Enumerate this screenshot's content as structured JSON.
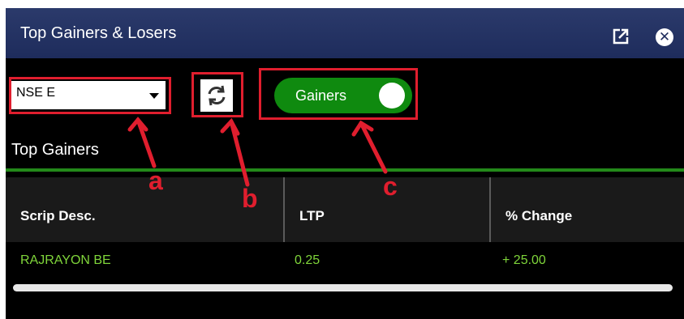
{
  "window": {
    "title": "Top Gainers & Losers",
    "popout_icon": "external-link-icon",
    "close_icon": "close-circle-icon"
  },
  "toolbar": {
    "exchange_select": {
      "value": "NSE E",
      "arrow_icon": "caret-down-icon"
    },
    "refresh_icon": "refresh-icon",
    "toggle": {
      "label": "Gainers",
      "state": "on",
      "color": "#0f8a0f"
    }
  },
  "section": {
    "title": "Top Gainers"
  },
  "table": {
    "columns": [
      "Scrip Desc.",
      "LTP",
      "% Change"
    ],
    "rows": [
      {
        "scrip": "RAJRAYON BE",
        "ltp": "0.25",
        "change": "+ 25.00"
      }
    ]
  },
  "annotations": {
    "labels": [
      "a",
      "b",
      "c"
    ],
    "color": "#e01e2e"
  }
}
